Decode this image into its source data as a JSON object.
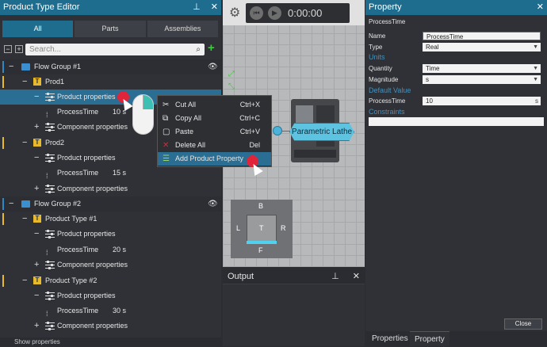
{
  "left_panel": {
    "title": "Product Type Editor",
    "tabs": [
      "All",
      "Parts",
      "Assemblies"
    ],
    "search_placeholder": "Search...",
    "rows": {
      "fg1": "Flow Group #1",
      "prod1": "Prod1",
      "pp1": "Product properties",
      "pt1": "ProcessTime",
      "pt1_val": "10 s",
      "cp1": "Component properties",
      "prod2": "Prod2",
      "pp2": "Product properties",
      "pt2": "ProcessTime",
      "pt2_val": "15 s",
      "cp2": "Component properties",
      "fg2": "Flow Group #2",
      "ptype1": "Product Type #1",
      "pp3": "Product properties",
      "pt3": "ProcessTime",
      "pt3_val": "20 s",
      "cp3": "Component properties",
      "ptype2": "Product Type #2",
      "pp4": "Product properties",
      "pt4": "ProcessTime",
      "pt4_val": "30 s",
      "cp4": "Component properties"
    },
    "bottom_text": "Show properties"
  },
  "context_menu": {
    "items": [
      {
        "label": "Cut All",
        "shortcut": "Ctrl+X",
        "icon": "scissors-icon"
      },
      {
        "label": "Copy All",
        "shortcut": "Ctrl+C",
        "icon": "copy-icon"
      },
      {
        "label": "Paste",
        "shortcut": "Ctrl+V",
        "icon": "paste-icon"
      },
      {
        "label": "Delete All",
        "shortcut": "Del",
        "icon": "delete-icon"
      },
      {
        "label": "Add Product Property",
        "shortcut": "",
        "icon": "add-property-icon"
      }
    ]
  },
  "viewport": {
    "time": "0:00:00",
    "callout": "Parametric Lathe",
    "cube": {
      "top": "B",
      "left": "L",
      "center": "T",
      "right": "R",
      "bottom": "F"
    }
  },
  "output": {
    "title": "Output"
  },
  "property": {
    "title": "Property",
    "heading": "ProcessTime",
    "name_label": "Name",
    "name_value": "ProcessTime",
    "type_label": "Type",
    "type_value": "Real",
    "units_section": "Units",
    "quantity_label": "Quantity",
    "quantity_value": "Time",
    "magnitude_label": "Magnitude",
    "magnitude_value": "s",
    "default_section": "Default Value",
    "default_label": "ProcessTime",
    "default_value": "10",
    "default_unit": "s",
    "constraints_section": "Constraints",
    "close_label": "Close",
    "tabs": [
      "Properties",
      "Property"
    ]
  },
  "colors": {
    "accent": "#1e6d8f",
    "selection": "#2a6e93",
    "flow_folder": "#3a8fd0",
    "product_marker": "#e8b92a",
    "add_green": "#3ec93e",
    "click_red": "#e0253a"
  }
}
